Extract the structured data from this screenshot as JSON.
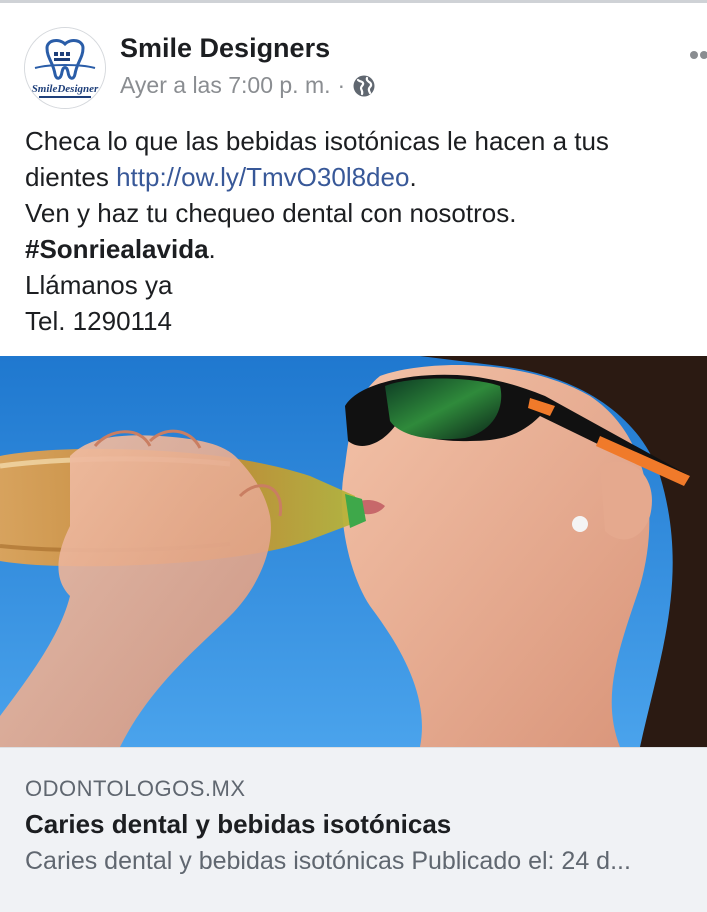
{
  "post": {
    "author": "Smile Designers",
    "logo_text": "SmileDesigner",
    "timestamp": "Ayer a las 7:00 p. m.",
    "separator": "·",
    "audience_icon": "globe-icon",
    "more_icon": "more-options-icon",
    "text": {
      "line1": "Checa lo que las bebidas isotónicas le hacen a tus",
      "line2_prefix": "dientes ",
      "link": "http://ow.ly/TmvO30l8deo",
      "line2_suffix": ".",
      "line3": "Ven y haz tu chequeo dental con nosotros.",
      "hashtag": "#Sonriealavida",
      "hashtag_suffix": ".",
      "line5": "Llámanos ya",
      "line6": "Tel. 1290114"
    }
  },
  "link_preview": {
    "domain": "ODONTOLOGOS.MX",
    "title": "Caries dental y bebidas isotónicas",
    "description": "Caries dental y bebidas isotónicas Publicado el: 24 d..."
  },
  "colors": {
    "link": "#385898",
    "secondary_text": "#8a8d91",
    "preview_bg": "#f0f2f5",
    "sky": "#2f86d6"
  }
}
